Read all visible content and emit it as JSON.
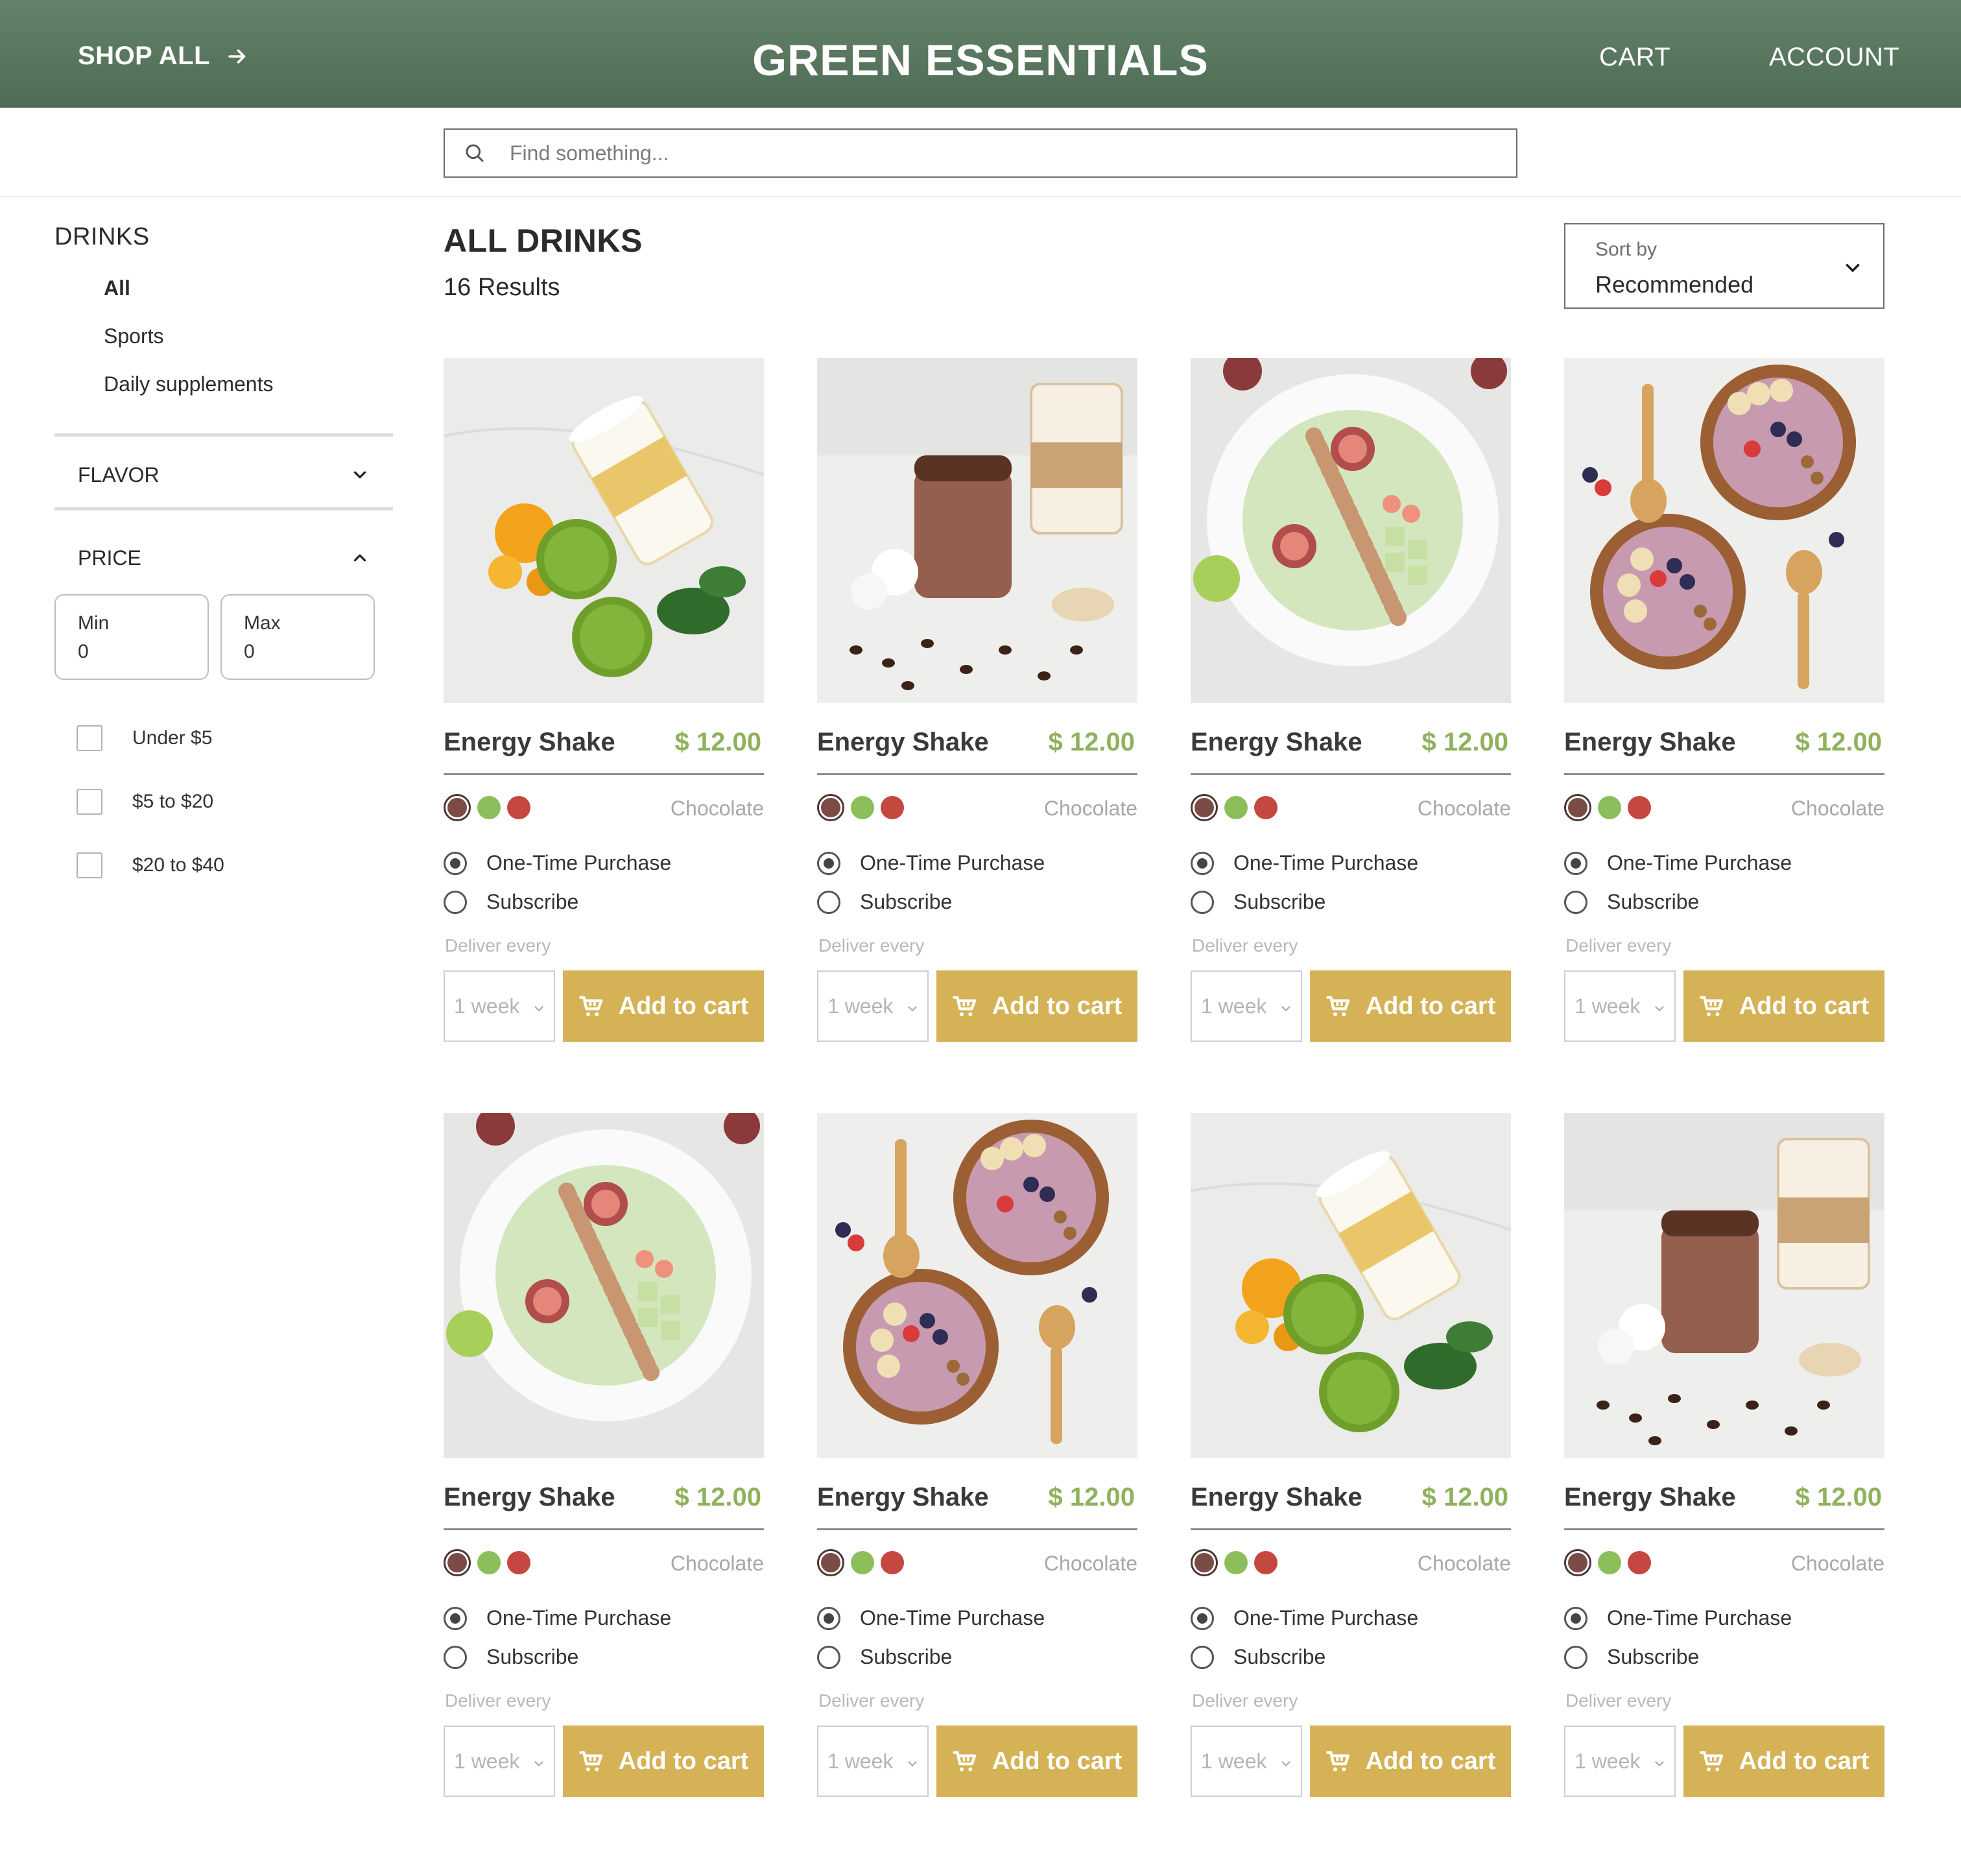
{
  "header": {
    "shop_all": "SHOP ALL",
    "brand": "GREEN ESSENTIALS",
    "cart": "CART",
    "account": "ACCOUNT",
    "background": "#5b7860"
  },
  "search": {
    "placeholder": "Find something..."
  },
  "sidebar": {
    "title": "DRINKS",
    "categories": [
      "All",
      "Sports",
      "Daily supplements"
    ],
    "flavor_label": "FLAVOR",
    "price_label": "PRICE",
    "min_label": "Min",
    "min_value": "0",
    "max_label": "Max",
    "max_value": "0",
    "price_ranges": [
      "Under $5",
      "$5 to $20",
      "$20 to $40"
    ]
  },
  "main": {
    "heading": "ALL DRINKS",
    "results": "16 Results",
    "sort_label": "Sort by",
    "sort_value": "Recommended"
  },
  "product_common": {
    "one_time": "One-Time Purchase",
    "subscribe": "Subscribe",
    "deliver_every": "Deliver every",
    "frequency": "1 week",
    "add_to_cart": "Add to cart",
    "swatch_colors": [
      "#7b4b45",
      "#8cbf5c",
      "#c44840"
    ],
    "price_color": "#8fb25c",
    "button_color": "#d4b255"
  },
  "products": [
    {
      "name": "Energy Shake",
      "price": "$ 12.00",
      "flavor": "Chocolate",
      "image": "green-smoothie-photo"
    },
    {
      "name": "Energy Shake",
      "price": "$ 12.00",
      "flavor": "Chocolate",
      "image": "chocolate-shake-photo"
    },
    {
      "name": "Energy Shake",
      "price": "$ 12.00",
      "flavor": "Chocolate",
      "image": "fig-bowl-photo"
    },
    {
      "name": "Energy Shake",
      "price": "$ 12.00",
      "flavor": "Chocolate",
      "image": "acai-bowls-photo"
    },
    {
      "name": "Energy Shake",
      "price": "$ 12.00",
      "flavor": "Chocolate",
      "image": "fig-bowl-photo"
    },
    {
      "name": "Energy Shake",
      "price": "$ 12.00",
      "flavor": "Chocolate",
      "image": "acai-bowls-photo"
    },
    {
      "name": "Energy Shake",
      "price": "$ 12.00",
      "flavor": "Chocolate",
      "image": "green-smoothie-photo"
    },
    {
      "name": "Energy Shake",
      "price": "$ 12.00",
      "flavor": "Chocolate",
      "image": "chocolate-shake-photo"
    }
  ]
}
